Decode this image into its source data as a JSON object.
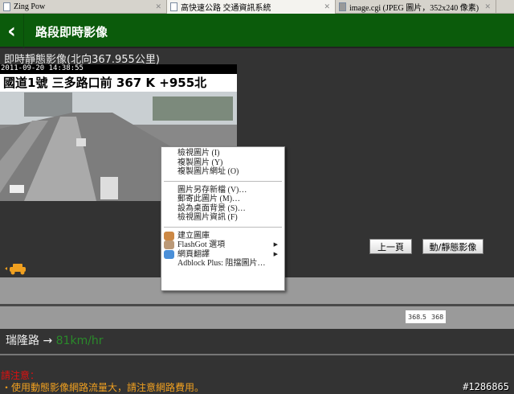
{
  "tabs": [
    {
      "label": "Zing Pow",
      "active": false
    },
    {
      "label": "高快速公路 交通資訊系統",
      "active": true
    },
    {
      "label": "image.cgi (JPEG 圖片，352x240 像素)",
      "active": false
    }
  ],
  "header": {
    "back_icon": "chevron-left-icon",
    "title": "路段即時影像"
  },
  "camera": {
    "subtitle": "即時靜態影像(北向367.955公里)",
    "timestamp": "2011-09-20 14:38:55",
    "caption": "國道1號 三多路口前 367 K +955北"
  },
  "buttons": {
    "prev": "上一頁",
    "toggle": "動/靜態影像"
  },
  "km_markers": [
    "368.5",
    "368"
  ],
  "speed": {
    "road": "瑞隆路",
    "arrow": "→",
    "value": "81km/hr",
    "color": "#2a8a2a"
  },
  "notice": {
    "title": "請注意：",
    "text": "・使用動態影像網路流量大，請注意網路費用。"
  },
  "watermark": "#1286865",
  "context_menu": {
    "group1": [
      "檢視圖片 (I)",
      "複製圖片 (Y)",
      "複製圖片網址 (O)"
    ],
    "group2": [
      "圖片另存新檔 (V)…",
      "郵寄此圖片 (M)…",
      "設為桌面背景 (S)…",
      "檢視圖片資訊 (F)"
    ],
    "group3": [
      "建立圖庫",
      "FlashGot 選項",
      "網頁翻譯",
      "Adblock Plus: 阻擋圖片…"
    ]
  },
  "colors": {
    "header": "#0b5b0b",
    "notice_title": "#e01010",
    "notice_text": "#f0a020"
  }
}
